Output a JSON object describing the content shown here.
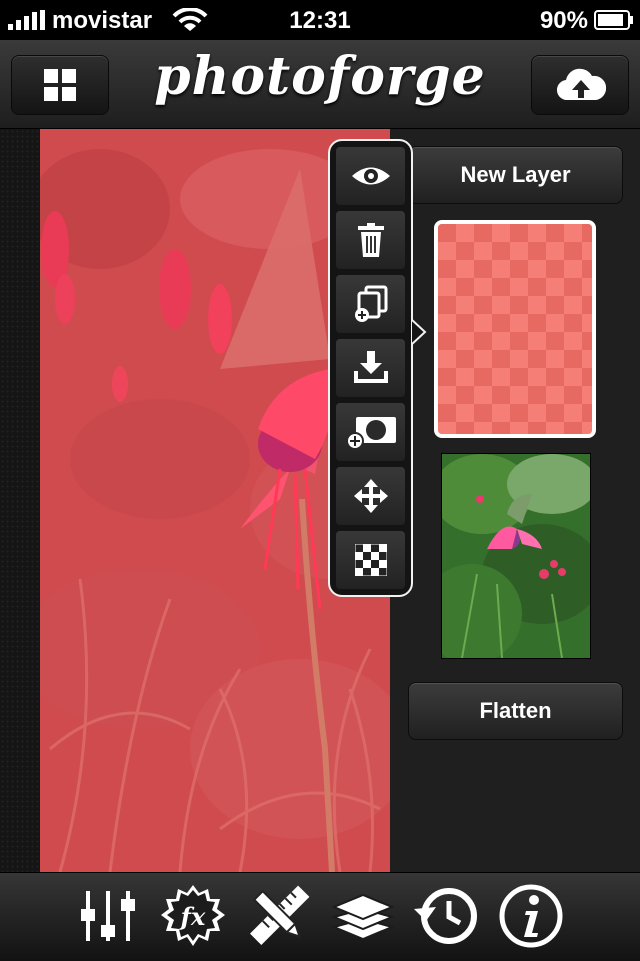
{
  "status_bar": {
    "carrier": "movistar",
    "time": "12:31",
    "battery": "90%",
    "battery_level": 0.9
  },
  "header": {
    "title": "photoforge",
    "left_button_icon": "grid-icon",
    "right_button_icon": "cloud-upload-icon"
  },
  "layer_menu": {
    "items": [
      {
        "icon": "eye-icon"
      },
      {
        "icon": "trash-icon"
      },
      {
        "icon": "duplicate-layer-icon"
      },
      {
        "icon": "import-icon"
      },
      {
        "icon": "add-mask-icon"
      },
      {
        "icon": "move-icon"
      },
      {
        "icon": "transparency-icon"
      }
    ]
  },
  "layers_panel": {
    "new_layer_label": "New Layer",
    "flatten_label": "Flatten",
    "layers": [
      {
        "name": "transparent-layer",
        "selected": true,
        "color": "#f2766d"
      },
      {
        "name": "photo-layer",
        "selected": false
      }
    ]
  },
  "toolbar": {
    "items": [
      {
        "icon": "adjustments-icon"
      },
      {
        "icon": "fx-icon"
      },
      {
        "icon": "tools-icon"
      },
      {
        "icon": "layers-icon"
      },
      {
        "icon": "history-icon"
      },
      {
        "icon": "info-icon"
      }
    ]
  },
  "colors": {
    "accent": "#ff3a4a",
    "overlay": "#f2766d"
  }
}
